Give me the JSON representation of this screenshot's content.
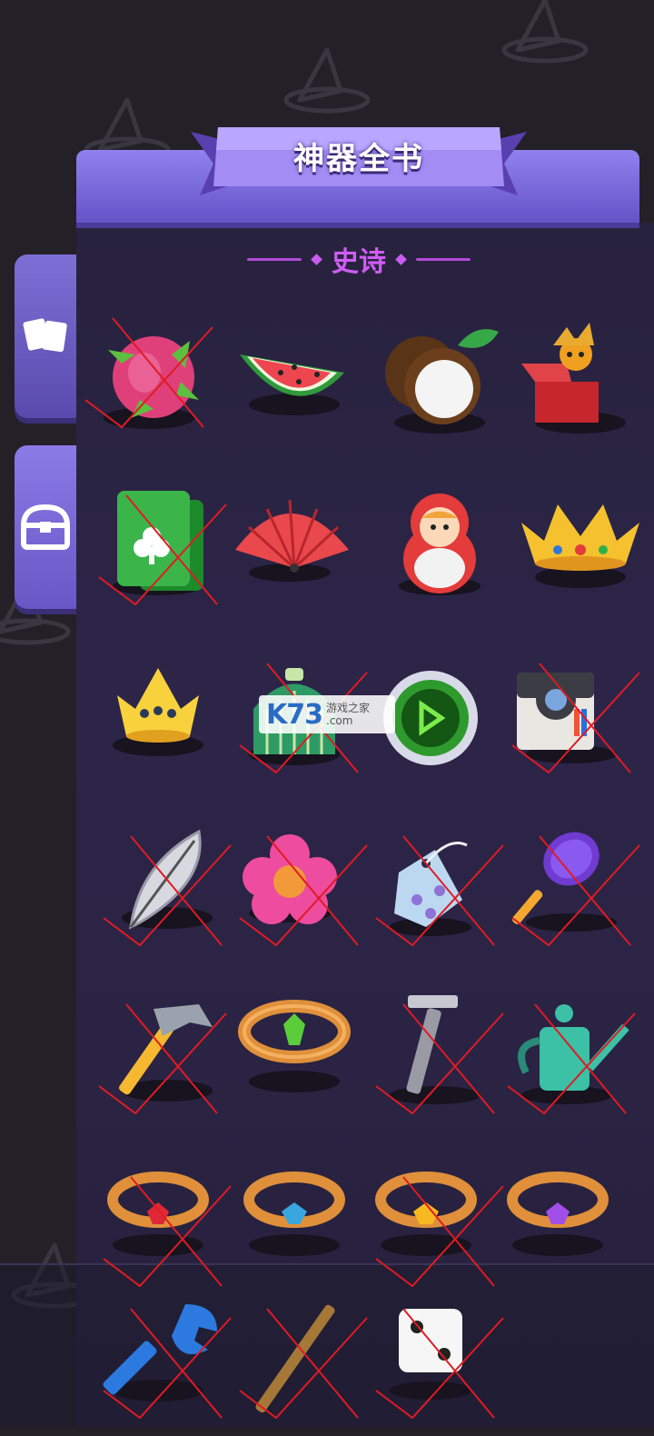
{
  "header": {
    "title": "神器全书"
  },
  "section": {
    "label": "史诗"
  },
  "side_tabs": [
    {
      "name": "cards-tab",
      "icon": "cards-icon"
    },
    {
      "name": "chest-tab",
      "icon": "treasure-chest-icon"
    }
  ],
  "watermark": {
    "brand": "K73",
    "line1": "游戏之家",
    "line2": ".com"
  },
  "items": [
    {
      "icon": "dragon-fruit-icon",
      "crossed": true
    },
    {
      "icon": "watermelon-icon",
      "crossed": false
    },
    {
      "icon": "coconut-icon",
      "crossed": false
    },
    {
      "icon": "jack-in-the-box-icon",
      "crossed": false
    },
    {
      "icon": "playing-cards-icon",
      "crossed": true
    },
    {
      "icon": "folding-fan-icon",
      "crossed": false
    },
    {
      "icon": "matryoshka-doll-icon",
      "crossed": false
    },
    {
      "icon": "golden-crown-icon",
      "crossed": false
    },
    {
      "icon": "small-crown-icon",
      "crossed": false
    },
    {
      "icon": "bell-cage-icon",
      "crossed": true
    },
    {
      "icon": "bottle-cap-icon",
      "crossed": false
    },
    {
      "icon": "instant-camera-icon",
      "crossed": true
    },
    {
      "icon": "feather-icon",
      "crossed": true
    },
    {
      "icon": "pink-flower-icon",
      "crossed": true
    },
    {
      "icon": "charm-tag-icon",
      "crossed": true
    },
    {
      "icon": "tennis-racket-icon",
      "crossed": true
    },
    {
      "icon": "hammer-icon",
      "crossed": true
    },
    {
      "icon": "emerald-ring-icon",
      "crossed": false
    },
    {
      "icon": "razor-icon",
      "crossed": true
    },
    {
      "icon": "watering-can-icon",
      "crossed": true
    },
    {
      "icon": "ruby-ring-icon",
      "crossed": true
    },
    {
      "icon": "sapphire-ring-icon",
      "crossed": false
    },
    {
      "icon": "topaz-ring-icon",
      "crossed": true
    },
    {
      "icon": "amethyst-ring-icon",
      "crossed": false
    },
    {
      "icon": "wrench-icon",
      "crossed": true
    },
    {
      "icon": "flute-icon",
      "crossed": true
    },
    {
      "icon": "dice-icon",
      "crossed": true
    }
  ]
}
